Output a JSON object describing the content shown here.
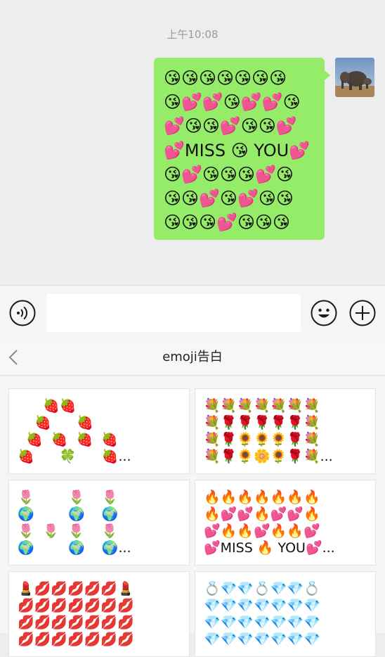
{
  "chat": {
    "timestamp": "上午10:08",
    "message_lines": [
      "😘😘😘😘😘😘😘",
      "😘💕💕😘💕💕😘",
      "💕😘😘💕😘😘💕",
      "💕MISS 😘 YOU💕",
      "😘💕😘😘😘💕😘",
      "😘😘💕😘💕😘😘",
      "😘😘😘💕😘😘😘"
    ]
  },
  "input_bar": {
    "input_value": ""
  },
  "panel": {
    "title": "emoji告白",
    "cards": [
      {
        "lines": [
          "      🍓🍓",
          "    🍓      🍓",
          "  🍓  🍓  🍓  🍓",
          "🍓      🍀      🍓..."
        ]
      },
      {
        "lines": [
          "💐💐💐💐💐💐💐",
          "💐🌹🌹🌹🌹🌹💐",
          "💐🌹🌻🌻🌻🌹💐",
          "💐🌹🌻🌼🌻🌹💐..."
        ]
      },
      {
        "lines": [
          "🌷        🌷    🌷",
          "🌍        🌍    🌍",
          "🌷  🌷  🌷    🌷",
          "🌍        🌍    🌍..."
        ]
      },
      {
        "lines": [
          "🔥🔥🔥🔥🔥🔥🔥",
          "🔥💕💕🔥💕💕🔥",
          "💕🔥🔥💕🔥🔥💕",
          "💕MISS 🔥 YOU💕..."
        ]
      },
      {
        "lines": [
          "💄💋💋💋💋💋💄",
          "💋💋💋💋💋💋💋",
          "💋💋💋💋💋💋💋",
          "💋💋💋💋💋💋💋"
        ]
      },
      {
        "lines": [
          "💍💎💎💍💎💎💍",
          "💎💎💎💎💎💎💎",
          "💎💎💎💎💎💎💎",
          "💎💎💎💎💎💎💎"
        ]
      }
    ]
  },
  "colors": {
    "bubble": "#95ec69",
    "chat_background": "#ededed",
    "panel_background": "#f5f5f5"
  },
  "icons": {
    "voice": "voice-icon",
    "emoji": "emoji-icon",
    "plus": "plus-icon",
    "back": "chevron-left-icon",
    "avatar": "elephant-avatar"
  }
}
